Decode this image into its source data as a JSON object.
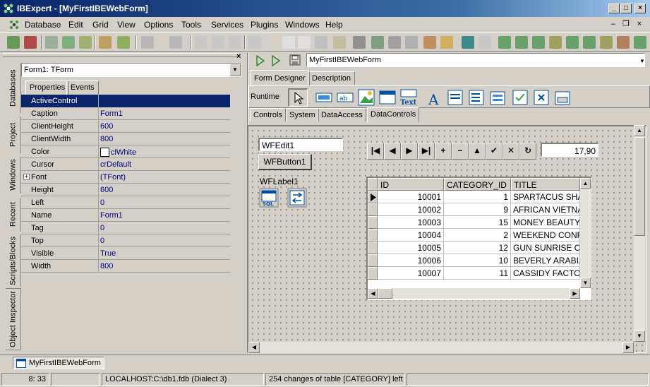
{
  "window": {
    "title": "IBExpert - [MyFirstIBEWebForm]"
  },
  "menu": [
    "Database",
    "Edit",
    "Grid",
    "View",
    "Options",
    "Tools",
    "Services",
    "Plugins",
    "Windows",
    "Help"
  ],
  "side_tabs": [
    "Databases",
    "Project",
    "Windows",
    "Recent",
    "Scripts/Blocks",
    "Object Inspector"
  ],
  "inspector": {
    "object": "Form1: TForm",
    "tabs": [
      "Properties",
      "Events"
    ],
    "properties": [
      {
        "name": "ActiveControl",
        "value": ""
      },
      {
        "name": "Caption",
        "value": "Form1"
      },
      {
        "name": "ClientHeight",
        "value": "600"
      },
      {
        "name": "ClientWidth",
        "value": "800"
      },
      {
        "name": "Color",
        "value": "clWhite"
      },
      {
        "name": "Cursor",
        "value": "crDefault"
      },
      {
        "name": "Font",
        "value": "(TFont)"
      },
      {
        "name": "Height",
        "value": "600"
      },
      {
        "name": "Left",
        "value": "0"
      },
      {
        "name": "Name",
        "value": "Form1"
      },
      {
        "name": "Tag",
        "value": "0"
      },
      {
        "name": "Top",
        "value": "0"
      },
      {
        "name": "Visible",
        "value": "True"
      },
      {
        "name": "Width",
        "value": "800"
      }
    ]
  },
  "designer": {
    "form_name": "MyFirstIBEWebForm",
    "tabs": [
      "Form Designer",
      "Description"
    ],
    "runtime_label": "Runtime",
    "palette_text_label": "Text",
    "palette_tabs": [
      "Controls",
      "System",
      "DataAccess",
      "DataControls"
    ],
    "edit_text": "WFEdit1",
    "button_text": "WFButton1",
    "label_text": "WFLabel1",
    "sql_label": "SQL",
    "number_value": "17,90",
    "grid": {
      "columns": [
        "ID",
        "CATEGORY_ID",
        "TITLE"
      ],
      "rows": [
        [
          "10001",
          "1",
          "SPARTACUS SHAK"
        ],
        [
          "10002",
          "9",
          "AFRICAN VIETNAM"
        ],
        [
          "10003",
          "15",
          "MONEY BEAUTY S"
        ],
        [
          "10004",
          "2",
          "WEEKEND CONFID"
        ],
        [
          "10005",
          "12",
          "GUN SUNRISE CUF"
        ],
        [
          "10006",
          "10",
          "BEVERLY ARABIA I"
        ],
        [
          "10007",
          "11",
          "CASSIDY FACTORY"
        ]
      ]
    }
  },
  "window_tab": "MyFirstIBEWebForm",
  "status": {
    "position": "8:  33",
    "connection": "LOCALHOST:C:\\db1.fdb (Dialect 3)",
    "message": "254 changes of table [CATEGORY] left"
  }
}
